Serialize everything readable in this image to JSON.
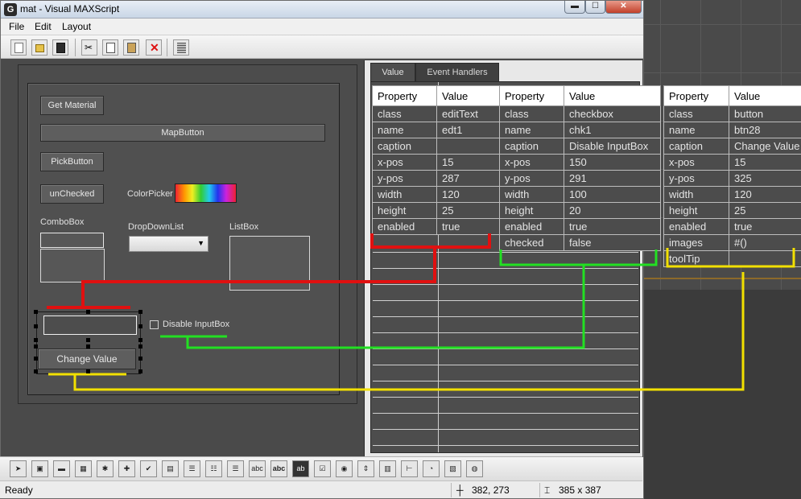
{
  "window": {
    "title": "mat - Visual MAXScript",
    "icon": "G"
  },
  "menu": [
    "File",
    "Edit",
    "Layout"
  ],
  "tabs": {
    "value": "Value",
    "events": "Event Handlers"
  },
  "rollout": {
    "get_material": "Get Material",
    "mapbutton": "MapButton",
    "pickbutton": "PickButton",
    "unchecked": "unChecked",
    "colorpicker": "ColorPicker",
    "combobox": "ComboBox",
    "dropdownlist": "DropDownList",
    "listbox": "ListBox",
    "checkbox_caption": "Disable InputBox",
    "change_value": "Change Value"
  },
  "table_headers": {
    "property": "Property",
    "value": "Value"
  },
  "table_edittext": [
    [
      "class",
      "editText"
    ],
    [
      "name",
      "edt1"
    ],
    [
      "caption",
      ""
    ],
    [
      "x-pos",
      "15"
    ],
    [
      "y-pos",
      "287"
    ],
    [
      "width",
      "120"
    ],
    [
      "height",
      "25"
    ],
    [
      "enabled",
      "true"
    ]
  ],
  "table_checkbox": [
    [
      "class",
      "checkbox"
    ],
    [
      "name",
      "chk1"
    ],
    [
      "caption",
      "Disable InputBox"
    ],
    [
      "x-pos",
      "150"
    ],
    [
      "y-pos",
      "291"
    ],
    [
      "width",
      "100"
    ],
    [
      "height",
      "20"
    ],
    [
      "enabled",
      "true"
    ],
    [
      "checked",
      "false"
    ]
  ],
  "table_button": [
    [
      "class",
      "button"
    ],
    [
      "name",
      "btn28"
    ],
    [
      "caption",
      "Change Value"
    ],
    [
      "x-pos",
      "15"
    ],
    [
      "y-pos",
      "325"
    ],
    [
      "width",
      "120"
    ],
    [
      "height",
      "25"
    ],
    [
      "enabled",
      "true"
    ],
    [
      "images",
      "#()"
    ],
    [
      "toolTip",
      ""
    ]
  ],
  "status": {
    "text": "Ready",
    "position": "382, 273",
    "size": "385 x 387"
  },
  "colors": {
    "red": "#e01010",
    "green": "#22e022",
    "yellow": "#f2e000"
  },
  "icons": [
    "new-icon",
    "open-icon",
    "save-icon",
    "cut-icon",
    "copy-icon",
    "paste-icon",
    "delete-icon",
    "grid-icon"
  ]
}
